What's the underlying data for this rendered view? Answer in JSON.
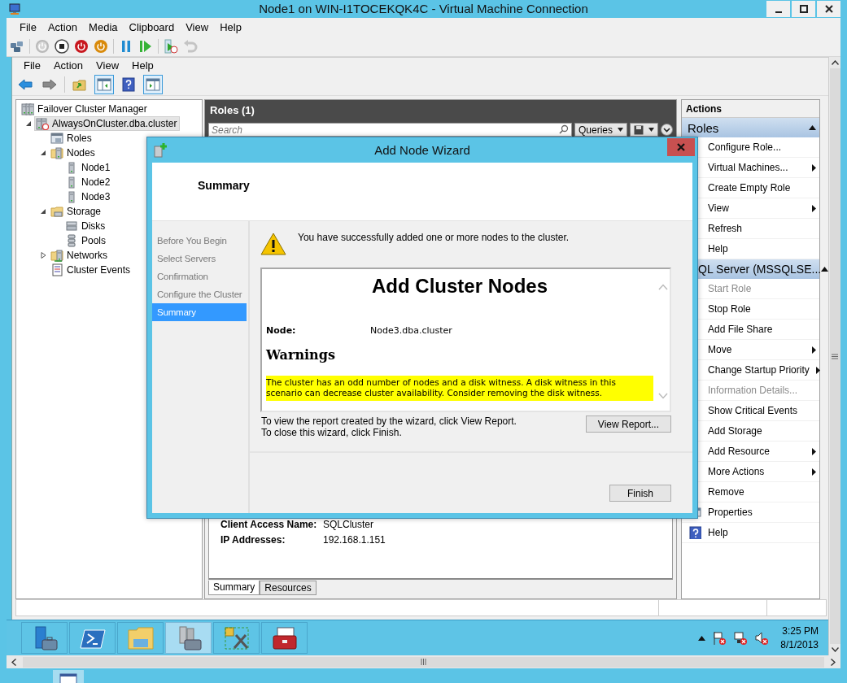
{
  "vm_window": {
    "title": "Node1 on WIN-I1TOCEKQK4C - Virtual Machine Connection",
    "menu": [
      "File",
      "Action",
      "Media",
      "Clipboard",
      "View",
      "Help"
    ],
    "toolbar": [
      {
        "kind": "ctrl-alt-del",
        "disabled": false
      },
      {
        "kind": "start",
        "disabled": true
      },
      {
        "kind": "turn-off",
        "disabled": false
      },
      {
        "kind": "shut-down",
        "disabled": false
      },
      {
        "kind": "save",
        "disabled": false
      },
      {
        "kind": "pause",
        "disabled": false
      },
      {
        "kind": "reset",
        "disabled": false
      },
      {
        "kind": "checkpoint",
        "disabled": false
      },
      {
        "kind": "revert",
        "disabled": true
      }
    ]
  },
  "mmc": {
    "menu": [
      "File",
      "Action",
      "View",
      "Help"
    ],
    "toolbar": [
      {
        "kind": "back",
        "pressed": false
      },
      {
        "kind": "forward",
        "pressed": false
      },
      {
        "kind": "up",
        "pressed": false
      },
      {
        "kind": "tree-pane",
        "pressed": true
      },
      {
        "kind": "help",
        "pressed": false
      },
      {
        "kind": "action-pane",
        "pressed": true
      }
    ]
  },
  "tree": [
    {
      "label": "Failover Cluster Manager",
      "kind": "manager",
      "selected": false,
      "children": [
        {
          "label": "AlwaysOnCluster.dba.cluster",
          "kind": "cluster",
          "selected": true,
          "expanded": true,
          "children": [
            {
              "label": "Roles",
              "kind": "roles",
              "selected": false
            },
            {
              "label": "Nodes",
              "kind": "nodes",
              "selected": false,
              "expanded": true,
              "children": [
                {
                  "label": "Node1",
                  "kind": "server",
                  "selected": false
                },
                {
                  "label": "Node2",
                  "kind": "server",
                  "selected": false
                },
                {
                  "label": "Node3",
                  "kind": "server",
                  "selected": false
                }
              ]
            },
            {
              "label": "Storage",
              "kind": "storage",
              "selected": false,
              "expanded": true,
              "children": [
                {
                  "label": "Disks",
                  "kind": "disks",
                  "selected": false
                },
                {
                  "label": "Pools",
                  "kind": "pools",
                  "selected": false
                }
              ]
            },
            {
              "label": "Networks",
              "kind": "networks",
              "selected": false,
              "expanded": false
            },
            {
              "label": "Cluster Events",
              "kind": "events",
              "selected": false
            }
          ]
        }
      ]
    }
  ],
  "roles_pane": {
    "title": "Roles (1)",
    "search_placeholder": "Search",
    "queries_button": "Queries",
    "details": [
      {
        "label": "Client Access Name:",
        "value": "SQLCluster"
      },
      {
        "label": "IP Addresses:",
        "value": "192.168.1.151"
      }
    ],
    "tabs": [
      {
        "label": "Summary",
        "selected": true
      },
      {
        "label": "Resources",
        "selected": false
      }
    ]
  },
  "actions": {
    "title": "Actions",
    "sections": [
      {
        "title": "Roles",
        "items": [
          {
            "label": "Configure Role...",
            "submenu": false,
            "disabled": false
          },
          {
            "label": "Virtual Machines...",
            "submenu": true,
            "disabled": false
          },
          {
            "label": "Create Empty Role",
            "submenu": false,
            "disabled": false
          },
          {
            "label": "View",
            "submenu": true,
            "disabled": false
          },
          {
            "label": "Refresh",
            "submenu": false,
            "disabled": false
          },
          {
            "label": "Help",
            "submenu": false,
            "disabled": false
          }
        ]
      },
      {
        "title": "QL Server (MSSQLSE...",
        "items": [
          {
            "label": "Start Role",
            "submenu": false,
            "disabled": true
          },
          {
            "label": "Stop Role",
            "submenu": false,
            "disabled": false
          },
          {
            "label": "Add File Share",
            "submenu": false,
            "disabled": false
          },
          {
            "label": "Move",
            "submenu": true,
            "disabled": false
          },
          {
            "label": "Change Startup Priority",
            "submenu": true,
            "disabled": false
          },
          {
            "label": "Information Details...",
            "submenu": false,
            "disabled": true
          },
          {
            "label": "Show Critical Events",
            "submenu": false,
            "disabled": false
          },
          {
            "label": "Add Storage",
            "submenu": false,
            "disabled": false
          },
          {
            "label": "Add Resource",
            "submenu": true,
            "disabled": false
          },
          {
            "label": "More Actions",
            "submenu": true,
            "disabled": false
          },
          {
            "label": "Remove",
            "submenu": false,
            "disabled": false
          },
          {
            "label": "Properties",
            "submenu": false,
            "disabled": false,
            "kind": "properties"
          },
          {
            "label": "Help",
            "submenu": false,
            "disabled": false,
            "kind": "help"
          }
        ]
      }
    ]
  },
  "wizard": {
    "title": "Add Node Wizard",
    "heading": "Summary",
    "steps": [
      {
        "label": "Before You Begin",
        "selected": false
      },
      {
        "label": "Select Servers",
        "selected": false
      },
      {
        "label": "Confirmation",
        "selected": false
      },
      {
        "label": "Configure the Cluster",
        "selected": false
      },
      {
        "label": "Summary",
        "selected": true
      }
    ],
    "message": "You have successfully added one or more nodes to the cluster.",
    "report": {
      "title": "Add Cluster Nodes",
      "node_label": "Node:",
      "node_value": "Node3.dba.cluster",
      "warnings_title": "Warnings",
      "warning": "The cluster has an odd number of nodes and a disk witness. A disk witness in this scenario can decrease cluster availability. Consider removing the disk witness."
    },
    "hints": [
      "To view the report created by the wizard, click View Report.",
      "To close this wizard, click Finish."
    ],
    "view_report_button": "View Report...",
    "finish_button": "Finish"
  },
  "taskbar": {
    "apps": [
      {
        "kind": "server-manager",
        "selected": false
      },
      {
        "kind": "powershell",
        "selected": false
      },
      {
        "kind": "explorer",
        "selected": false
      },
      {
        "kind": "cluster-manager",
        "selected": true
      },
      {
        "kind": "tools",
        "selected": false
      },
      {
        "kind": "toolbox",
        "selected": false
      }
    ],
    "clock": {
      "time": "3:25 PM",
      "date": "8/1/2013"
    }
  }
}
